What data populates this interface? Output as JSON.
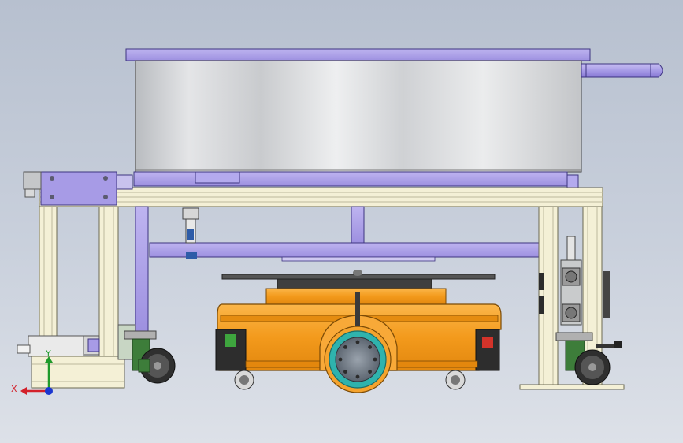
{
  "viewport": {
    "background_top": "#b7c0cf",
    "background_bottom": "#dde1e8"
  },
  "colors": {
    "frame_purple": "#a79be6",
    "frame_purple_dark": "#5e4fb8",
    "tube_cream": "#f4f0d6",
    "tube_edge": "#8d8a6e",
    "agv_orange": "#f39a1c",
    "agv_orange_dark": "#b86a08",
    "wheel_teal": "#2fb3ad",
    "caster_green": "#3d7d3a"
  },
  "triad": {
    "x_label": "X",
    "y_label": "Y",
    "x_color": "#d3202a",
    "y_color": "#1f9a2a",
    "z_color": "#1a36d0"
  }
}
